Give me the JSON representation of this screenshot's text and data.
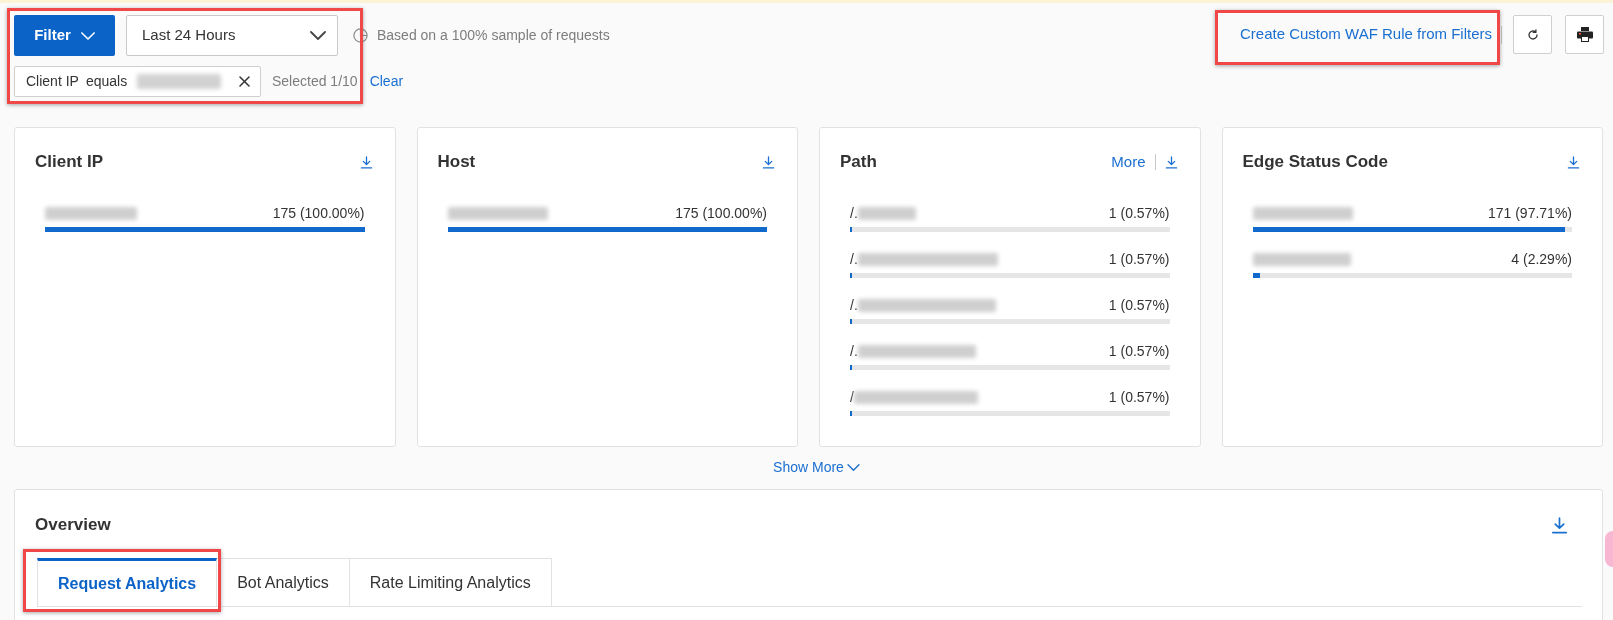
{
  "top_bar": {
    "highlighted": true,
    "filter_button": {
      "label": "Filter"
    },
    "time_range": {
      "value": "Last 24 Hours"
    },
    "sample_note": "Based on a 100% sample of requests",
    "filter_chip": {
      "field": "Client IP",
      "operator": "equals"
    },
    "selection_count": "Selected 1/10",
    "clear_link": "Clear"
  },
  "actions": {
    "create_rule_link": {
      "label": "Create Custom WAF Rule from Filters",
      "highlighted": true
    }
  },
  "cards": [
    {
      "title": "Client IP",
      "rows": [
        {
          "value": "175 (100.00%)",
          "level": 1
        }
      ]
    },
    {
      "title": "Host",
      "rows": [
        {
          "value": "175 (100.00%)",
          "level": 1
        }
      ]
    },
    {
      "title": "Path",
      "more_link": "More",
      "rows": [
        {
          "label": "/.",
          "value": "1 (0.57%)",
          "level": 0.0057
        },
        {
          "label": "/.",
          "value": "1 (0.57%)",
          "level": 0.0057
        },
        {
          "label": "/.",
          "value": "1 (0.57%)",
          "level": 0.0057
        },
        {
          "label": "/.",
          "value": "1 (0.57%)",
          "level": 0.0057
        },
        {
          "label": "/",
          "value": "1 (0.57%)",
          "level": 0.0057
        }
      ]
    },
    {
      "title": "Edge Status Code",
      "rows": [
        {
          "value": "171 (97.71%)",
          "level": 0.9771
        },
        {
          "value": "4 (2.29%)",
          "level": 0.0229
        }
      ]
    }
  ],
  "show_more": "Show More",
  "overview": {
    "title": "Overview",
    "tabs": [
      {
        "label": "Request Analytics",
        "selected": true,
        "highlighted": true
      },
      {
        "label": "Bot Analytics",
        "selected": false,
        "highlighted": false
      },
      {
        "label": "Rate Limiting Analytics",
        "selected": false,
        "highlighted": false
      }
    ]
  }
}
